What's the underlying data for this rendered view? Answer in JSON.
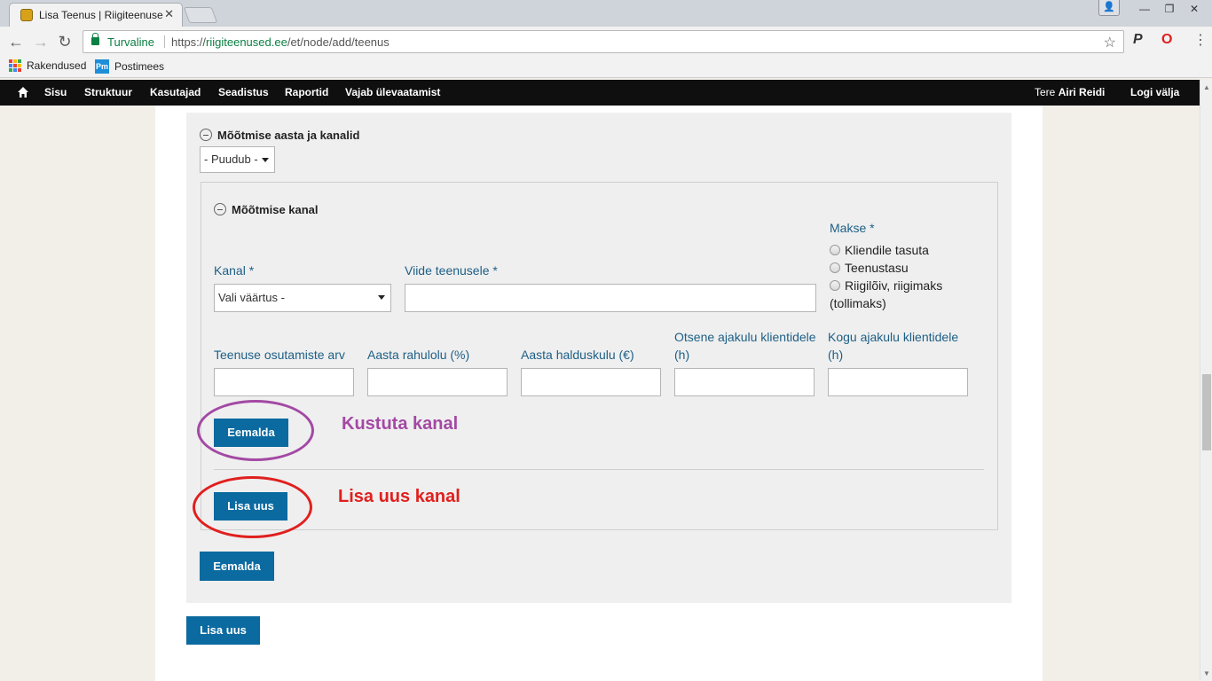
{
  "browser": {
    "tab_title": "Lisa Teenus | Riigiteenused",
    "security_label": "Turvaline",
    "url_scheme": "https://",
    "url_host": "riigiteenused.ee",
    "url_path": "/et/node/add/teenus",
    "bookmarks": [
      {
        "label": "Rakendused",
        "icon": "apps-grid-icon"
      },
      {
        "label": "Postimees",
        "icon": "pm-icon"
      }
    ]
  },
  "admin_toolbar": {
    "items": [
      "Sisu",
      "Struktuur",
      "Kasutajad",
      "Seadistus",
      "Raportid",
      "Vajab ülevaatamist"
    ],
    "greeting_prefix": "Tere ",
    "user_name": "Airi Reidi",
    "logout": "Logi välja"
  },
  "form": {
    "year_channels": {
      "legend": "Mõõtmise aasta ja kanalid",
      "select_value": "- Puudub -"
    },
    "channel": {
      "legend": "Mõõtmise kanal",
      "kanal_label": "Kanal *",
      "kanal_value": "Vali väärtus -",
      "link_label": "Viide teenusele *",
      "link_value": "",
      "payment_label": "Makse *",
      "payment_options": [
        "Kliendile tasuta",
        "Teenustasu",
        "Riigilõiv, riigimaks"
      ],
      "payment_option_cont": "(tollimaks)",
      "stats_labels": [
        "Teenuse osutamiste arv",
        "Aasta rahulolu (%)",
        "Aasta halduskulu (€)",
        "Otsene ajakulu klientidele (h)",
        "Kogu ajakulu klientidele (h)"
      ],
      "remove_button": "Eemalda",
      "add_button": "Lisa uus"
    },
    "outer_remove_button": "Eemalda",
    "outer_add_button": "Lisa uus"
  },
  "annotations": {
    "delete_channel": "Kustuta kanal",
    "add_channel": "Lisa uus kanal",
    "delete_color": "#a349a4",
    "add_color": "#e0201e"
  },
  "colors": {
    "button_blue": "#0b6aa0",
    "label_blue": "#1d5f86",
    "admin_bar": "#0f0f0f"
  }
}
